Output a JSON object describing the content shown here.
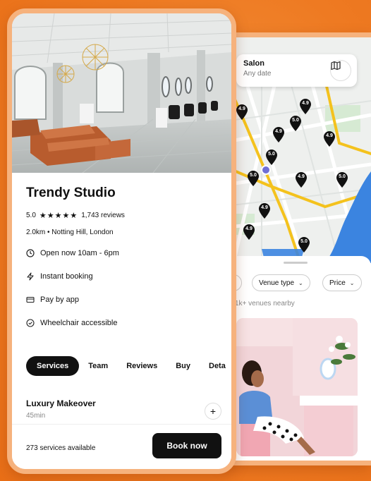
{
  "map_screen": {
    "search": {
      "title": "Salon",
      "subtitle": "Any date"
    },
    "map_button_icon": "map-icon",
    "pins": [
      "4.9",
      "4.9",
      "5.0",
      "4.9",
      "4.9",
      "5.0",
      "5.0",
      "4.9",
      "5.0",
      "4.9",
      "4.9",
      "5.0",
      "4.9"
    ],
    "filters": [
      {
        "label": ""
      },
      {
        "label": "Venue type"
      },
      {
        "label": "Price"
      }
    ],
    "nearby_text": "1k+ venues nearby"
  },
  "detail_screen": {
    "venue_name": "Trendy Studio",
    "rating": "5.0",
    "stars": "★★★★★",
    "reviews": "1,743 reviews",
    "location": "2.0km • Notting Hill, London",
    "info": {
      "hours": "Open now 10am - 6pm",
      "booking": "Instant booking",
      "payment": "Pay by app",
      "access": "Wheelchair accessible"
    },
    "tabs": [
      "Services",
      "Team",
      "Reviews",
      "Buy",
      "Deta"
    ],
    "active_tab": "Services",
    "service": {
      "name": "Luxury Makeover",
      "duration": "45min"
    },
    "footer": {
      "count": "273 services available",
      "book_label": "Book now"
    }
  },
  "colors": {
    "background": "#ee7a22",
    "frame": "#f6b27d",
    "accent": "#111111",
    "map_route": "#f4c21d",
    "water": "#3b84e0"
  }
}
